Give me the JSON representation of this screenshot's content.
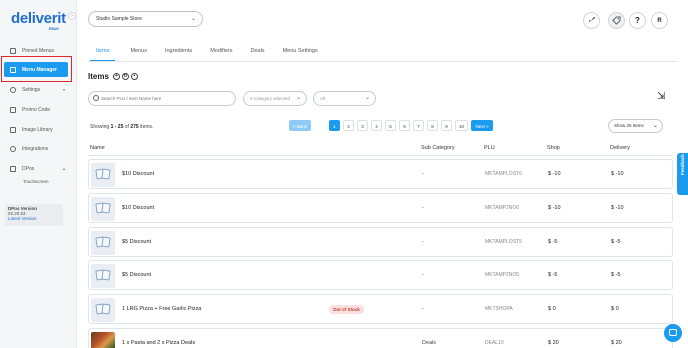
{
  "brand": {
    "logo": "deliverit",
    "logo_sub": "EBUS"
  },
  "sidebar": {
    "items": [
      {
        "label": "Pinned Menus"
      },
      {
        "label": "Menu Manager"
      },
      {
        "label": "Settings"
      },
      {
        "label": "Promo Code"
      },
      {
        "label": "Image Library"
      },
      {
        "label": "Integrations"
      },
      {
        "label": "DPos"
      }
    ],
    "sub_items": [
      "Touchscreen"
    ],
    "version": {
      "label": "DPos Version",
      "number": "02.20.53",
      "link": "Latest Version"
    }
  },
  "header": {
    "store": "Studio Sample Store",
    "user_initial": "R",
    "help": "?"
  },
  "tabs": [
    "Items",
    "Menus",
    "Ingredients",
    "Modifiers",
    "Deals",
    "Menu Settings"
  ],
  "page": {
    "title": "Items"
  },
  "filters": {
    "search_placeholder": "Search PLU / Item Name here",
    "category": "0 Category selected",
    "type": "All"
  },
  "pagination": {
    "showing_prefix": "Showing",
    "range": "1 - 25",
    "of": "of",
    "total": "275",
    "suffix": "items.",
    "prev": "< Back",
    "pages": [
      "1",
      "2",
      "3",
      "4",
      "5",
      "6",
      "7",
      "8",
      "9",
      "10"
    ],
    "next": "Next >",
    "page_size": "Show 25 Items"
  },
  "table": {
    "columns": [
      "Name",
      "Sub Category",
      "PLU",
      "Shop",
      "Delivery"
    ],
    "rows": [
      {
        "name": "$10 Discount",
        "sub": "-",
        "plu": "MKTAMPLOST6",
        "shop": "$ -10",
        "delivery": "$ -10",
        "badge": ""
      },
      {
        "name": "$10 Discount",
        "sub": "-",
        "plu": "MKTAMP2NO6",
        "shop": "$ -10",
        "delivery": "$ -10",
        "badge": ""
      },
      {
        "name": "$5 Discount",
        "sub": "-",
        "plu": "MKTAMPLOST5",
        "shop": "$ -5",
        "delivery": "$ -5",
        "badge": ""
      },
      {
        "name": "$5 Discount",
        "sub": "-",
        "plu": "MKTAMP2NO5",
        "shop": "$ -5",
        "delivery": "$ -5",
        "badge": ""
      },
      {
        "name": "1 LRG Pizza + Free Garlic Pizza",
        "sub": "-",
        "plu": "MKTSHOPA",
        "shop": "$ 0",
        "delivery": "$ 0",
        "badge": "Out of Stock"
      },
      {
        "name": "1 x Pasta and 2 x Pizza Deals",
        "sub": "Deals",
        "plu": "DEAL10",
        "shop": "$ 20",
        "delivery": "$ 20",
        "badge": ""
      }
    ]
  },
  "feedback_label": "Feedback",
  "colors": {
    "accent": "#1a9bf0",
    "brand": "#1f6fd1",
    "highlight": "#e0242b"
  }
}
